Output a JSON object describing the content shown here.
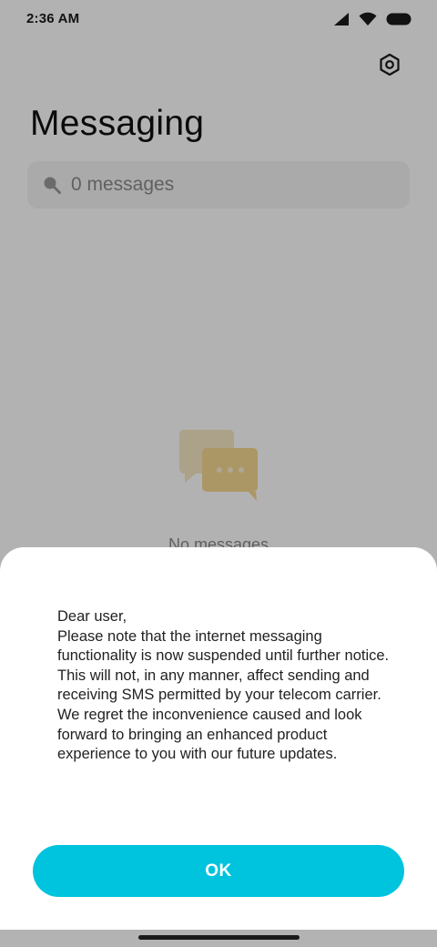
{
  "status_bar": {
    "time": "2:36 AM",
    "icons": [
      "cell-signal-icon",
      "wifi-icon",
      "battery-icon"
    ]
  },
  "header": {
    "title": "Messaging",
    "settings_icon": "gear-icon"
  },
  "search": {
    "placeholder": "0 messages",
    "icon": "search-icon"
  },
  "empty_state": {
    "icon": "chat-bubbles-icon",
    "text": "No messages"
  },
  "dialog": {
    "greeting": "Dear user,",
    "body": "Please note that the internet messaging functionality is now suspended until further notice. This will not, in any manner, affect sending and receiving SMS permitted by your telecom carrier. We regret the inconvenience caused and look forward to bringing an enhanced product experience to you with our future updates.",
    "ok_label": "OK"
  },
  "colors": {
    "accent": "#00c3de",
    "overlay": "#000000",
    "illustration": "#f7e3b1"
  }
}
